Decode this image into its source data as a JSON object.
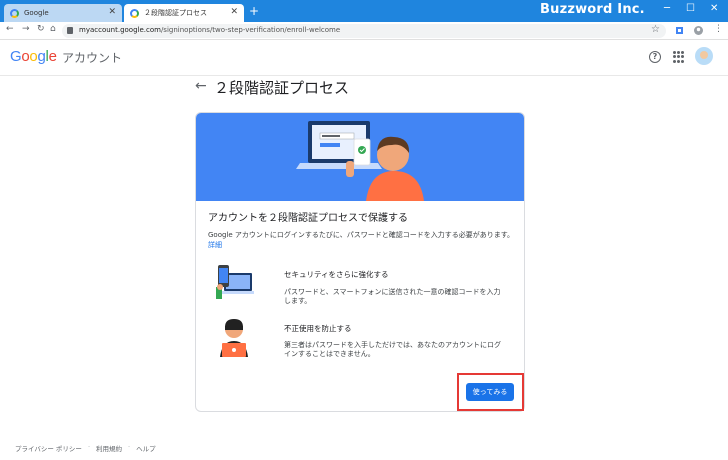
{
  "browser": {
    "tabs": [
      {
        "label": "Google",
        "active": false
      },
      {
        "label": "２段階認証プロセス",
        "active": true
      }
    ],
    "new_tab": "+",
    "brand": "Buzzword Inc.",
    "url_host": "myaccount.google.com",
    "url_path": "/signinoptions/two-step-verification/enroll-welcome",
    "controls": {
      "minimize": "─",
      "maximize": "☐",
      "close": "✕"
    }
  },
  "app": {
    "logo": {
      "letters": [
        "G",
        "o",
        "o",
        "g",
        "l",
        "e"
      ],
      "colors": [
        "#4285f4",
        "#ea4335",
        "#fbbc05",
        "#4285f4",
        "#34a853",
        "#ea4335"
      ]
    },
    "product": "アカウント"
  },
  "page": {
    "title": "２段階認証プロセス"
  },
  "card": {
    "heading": "アカウントを２段階認証プロセスで保護する",
    "description": "Google アカウントにログインするたびに、パスワードと確認コードを入力する必要があります。",
    "details_link": "詳細",
    "features": [
      {
        "title": "セキュリティをさらに強化する",
        "text": "パスワードと、スマートフォンに送信された一意の確認コードを入力します。"
      },
      {
        "title": "不正使用を防止する",
        "text": "第三者はパスワードを入手しただけでは、あなたのアカウントにログインすることはできません。"
      }
    ],
    "button": "使ってみる"
  },
  "footer": {
    "links": [
      "プライバシー ポリシー",
      "利用規約",
      "ヘルプ"
    ],
    "separator": "·"
  },
  "colors": {
    "titlebar": "#1f85de",
    "banner": "#4285f4",
    "button": "#1a73e8",
    "highlight": "#e53935"
  }
}
